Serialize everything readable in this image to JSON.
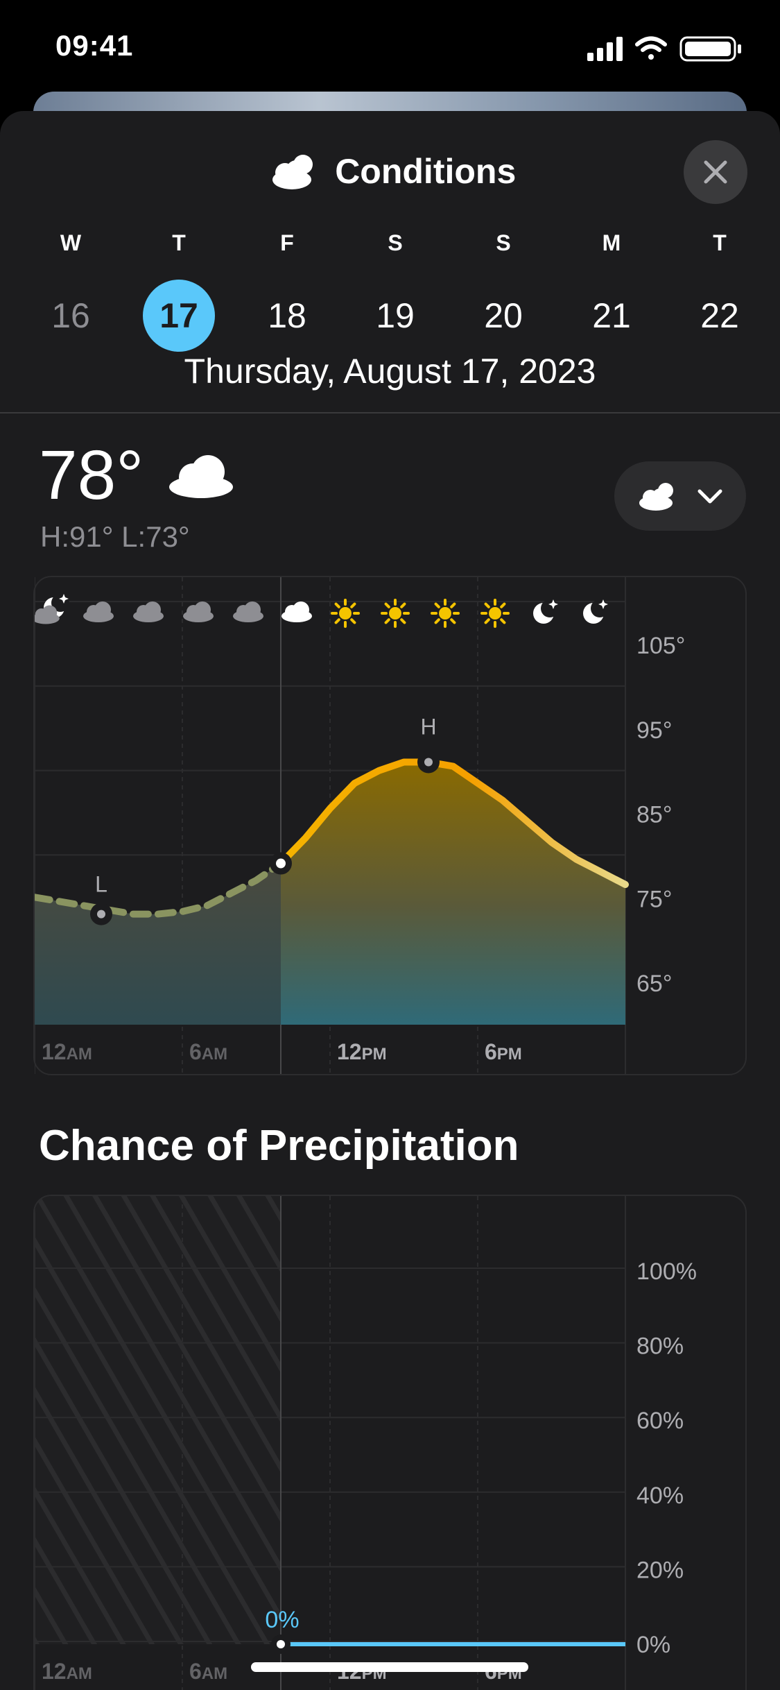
{
  "status_bar": {
    "time": "09:41"
  },
  "header": {
    "title": "Conditions",
    "icon": "cloud-sun-icon",
    "close_icon": "close-icon"
  },
  "week": {
    "days": [
      {
        "letter": "W",
        "number": "16",
        "state": "past"
      },
      {
        "letter": "T",
        "number": "17",
        "state": "selected"
      },
      {
        "letter": "F",
        "number": "18",
        "state": "future"
      },
      {
        "letter": "S",
        "number": "19",
        "state": "future"
      },
      {
        "letter": "S",
        "number": "20",
        "state": "future"
      },
      {
        "letter": "M",
        "number": "21",
        "state": "future"
      },
      {
        "letter": "T",
        "number": "22",
        "state": "future"
      }
    ],
    "selected_date": "Thursday, August 17, 2023"
  },
  "current": {
    "temp": "78°",
    "hilo": "H:91° L:73°",
    "icon": "cloud-icon"
  },
  "selector": {
    "icon": "cloud-sun-icon",
    "chevron": "chevron-down-icon"
  },
  "colors": {
    "accent": "#5ac8fa",
    "sheet_bg": "#1c1c1e",
    "temp_line": "#f5b400",
    "precip_line": "#5ac8fa"
  },
  "temp_chart": {
    "type": "area",
    "y_ticks": [
      "105°",
      "95°",
      "85°",
      "75°",
      "65°"
    ],
    "y_tick_values": [
      105,
      95,
      85,
      75,
      65
    ],
    "ylim": [
      60,
      110
    ],
    "x_ticks": [
      {
        "hour": 0,
        "num": "12",
        "unit": "AM"
      },
      {
        "hour": 6,
        "num": "6",
        "unit": "AM"
      },
      {
        "hour": 12,
        "num": "12",
        "unit": "PM"
      },
      {
        "hour": 18,
        "num": "6",
        "unit": "PM"
      }
    ],
    "x_range_hours": [
      0,
      24
    ],
    "now_hour": 10,
    "hours": [
      0,
      1,
      2,
      3,
      4,
      5,
      6,
      7,
      8,
      9,
      10,
      11,
      12,
      13,
      14,
      15,
      16,
      17,
      18,
      19,
      20,
      21,
      22,
      23,
      24
    ],
    "temps": [
      75,
      74.5,
      74,
      73.5,
      73,
      73,
      73.3,
      74,
      75.5,
      77,
      79,
      82,
      85.5,
      88.5,
      90,
      91,
      91,
      90.5,
      88.5,
      86.5,
      84,
      81.5,
      79.5,
      78,
      76.5
    ],
    "high": {
      "label": "H",
      "hour": 16,
      "value": 91
    },
    "low": {
      "label": "L",
      "hour": 4,
      "value": 73
    },
    "hourly_icons": [
      "cloud-moon-icon",
      "cloud-icon",
      "cloud-icon",
      "cloud-icon",
      "cloud-icon",
      "cloud-icon",
      "sun-icon",
      "sun-icon",
      "sun-icon",
      "sun-icon",
      "moon-icon",
      "moon-icon"
    ]
  },
  "precip": {
    "title": "Chance of Precipitation",
    "y_ticks": [
      "100%",
      "80%",
      "60%",
      "40%",
      "20%",
      "0%"
    ],
    "y_tick_values": [
      100,
      80,
      60,
      40,
      20,
      0
    ],
    "current_label": "0%",
    "x_ticks": [
      {
        "hour": 0,
        "num": "12",
        "unit": "AM"
      },
      {
        "hour": 6,
        "num": "6",
        "unit": "AM"
      },
      {
        "hour": 12,
        "num": "12",
        "unit": "PM"
      },
      {
        "hour": 18,
        "num": "6",
        "unit": "PM"
      }
    ],
    "chart_data": {
      "type": "line",
      "hours": [
        10,
        24
      ],
      "values": [
        0,
        0
      ],
      "ylim": [
        0,
        100
      ]
    }
  }
}
